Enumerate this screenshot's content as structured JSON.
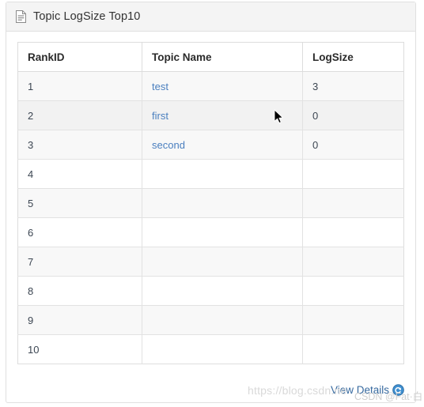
{
  "card": {
    "title": "Topic LogSize Top10",
    "title_icon": "document-icon"
  },
  "table": {
    "columns": [
      "RankID",
      "Topic Name",
      "LogSize"
    ],
    "rows": [
      {
        "rank": "1",
        "topic": "test",
        "logsize": "3"
      },
      {
        "rank": "2",
        "topic": "first",
        "logsize": "0"
      },
      {
        "rank": "3",
        "topic": "second",
        "logsize": "0"
      },
      {
        "rank": "4",
        "topic": "",
        "logsize": ""
      },
      {
        "rank": "5",
        "topic": "",
        "logsize": ""
      },
      {
        "rank": "6",
        "topic": "",
        "logsize": ""
      },
      {
        "rank": "7",
        "topic": "",
        "logsize": ""
      },
      {
        "rank": "8",
        "topic": "",
        "logsize": ""
      },
      {
        "rank": "9",
        "topic": "",
        "logsize": ""
      },
      {
        "rank": "10",
        "topic": "",
        "logsize": ""
      }
    ]
  },
  "footer": {
    "view_details_label": "View Details",
    "view_details_icon": "circular-arrow-icon"
  },
  "watermarks": {
    "blog_url": "https://blog.csdn.ne",
    "author": "CSDN @Fat·白"
  },
  "colors": {
    "link": "#4a7fbf",
    "footer_link": "#36699f",
    "header_bg": "#f4f4f4",
    "stripe": "#f8f8f8",
    "border": "#dddddd"
  }
}
